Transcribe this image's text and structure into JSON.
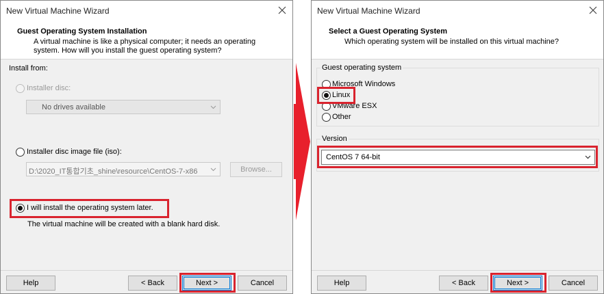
{
  "left": {
    "window_title": "New Virtual Machine Wizard",
    "header_title": "Guest Operating System Installation",
    "header_desc": "A virtual machine is like a physical computer; it needs an operating system. How will you install the guest operating system?",
    "install_from_label": "Install from:",
    "options": {
      "disc_label": "Installer disc:",
      "disc_combo_value": "No drives available",
      "iso_label": "Installer disc image file (iso):",
      "iso_path": "D:\\2020_IT통합기초_shine\\resource\\CentOS-7-x86",
      "browse_label": "Browse...",
      "later_label": "I will install the operating system later.",
      "later_desc": "The virtual machine will be created with a blank hard disk."
    },
    "footer": {
      "help": "Help",
      "back": "< Back",
      "next": "Next >",
      "cancel": "Cancel"
    }
  },
  "right": {
    "window_title": "New Virtual Machine Wizard",
    "header_title": "Select a Guest Operating System",
    "header_desc": "Which operating system will be installed on this virtual machine?",
    "guest_group_label": "Guest operating system",
    "os_options": [
      "Microsoft Windows",
      "Linux",
      "VMware ESX",
      "Other"
    ],
    "selected_os": "Linux",
    "version_group_label": "Version",
    "version_value": "CentOS 7 64-bit",
    "footer": {
      "help": "Help",
      "back": "< Back",
      "next": "Next >",
      "cancel": "Cancel"
    }
  },
  "colors": {
    "highlight": "#d9232e",
    "focus_blue": "#0078d7"
  }
}
